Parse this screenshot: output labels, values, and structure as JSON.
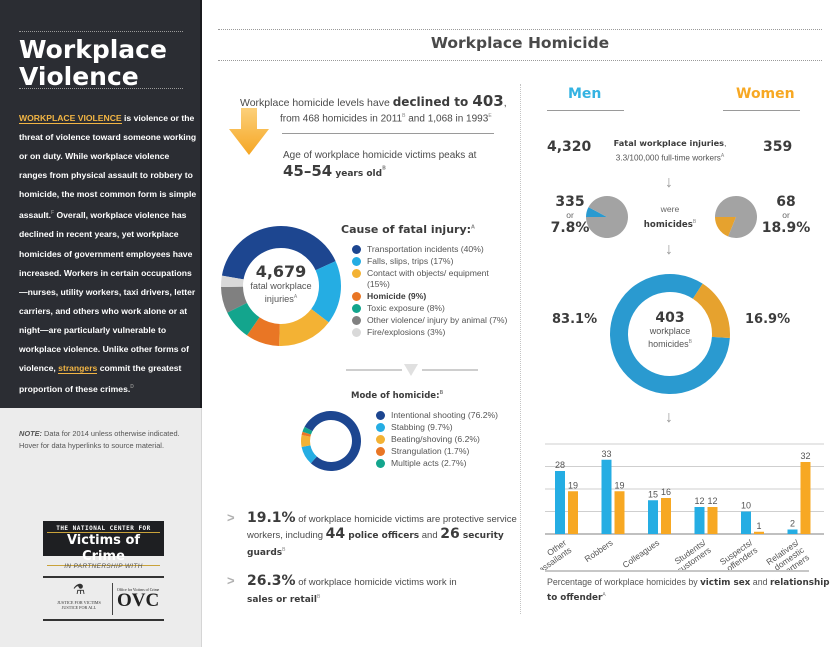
{
  "sidebar": {
    "title_line1": "Workplace",
    "title_line2": "Violence",
    "intro_highlight": "WORKPLACE VIOLENCE",
    "intro_text_1": " is violence or the threat of violence toward someone working or on duty.  While workplace violence ranges from physical assault to robbery to homicide, the most common form is simple assault.",
    "intro_sup_1": "F",
    "intro_text_2": " Overall, workplace violence has declined in recent years, yet workplace homicides of government employees have increased. Workers in certain occupations—nurses, utility workers, taxi drivers, letter carriers, and others who work alone or at night—are particularly vulnerable to workplace violence. Unlike other forms of violence, ",
    "intro_link": "strangers",
    "intro_text_3": " commit the greatest proportion of these crimes.",
    "intro_sup_2": "D",
    "note_label": "NOTE:",
    "note_text": " Data for 2014 unless otherwise indicated. Hover for data hyperlinks to source material.",
    "logo_ncvc_line1": "THE NATIONAL CENTER FOR",
    "logo_ncvc_line2": "Victims of Crime",
    "partnership": "IN PARTNERSHIP WITH",
    "logo_doj_line1": "JUSTICE FOR VICTIMS",
    "logo_doj_line2": "JUSTICE FOR ALL",
    "logo_ovc_small": "Office for Victims of Crime",
    "logo_ovc": "OVC"
  },
  "main": {
    "title": "Workplace Homicide",
    "decline": {
      "text_pre": "Workplace homicide levels have ",
      "bold": "declined to ",
      "bold_num": "403",
      "text_post": ",",
      "line2_a": "from 468 homicides in 2011",
      "line2_sup_a": "B",
      "line2_b": " and 1,068 in 1993",
      "line2_sup_b": "E"
    },
    "age": {
      "text": "Age of  workplace homicide victims peaks at",
      "range": "45–54",
      "suffix": " years old",
      "sup": "B"
    },
    "cause": {
      "title": "Cause of fatal injury:",
      "title_sup": "A",
      "center_num": "4,679",
      "center_label_1": "fatal workplace",
      "center_label_2": "injuries",
      "center_sup": "A"
    },
    "mode": {
      "title": "Mode of homicide:",
      "title_sup": "B"
    },
    "stats": [
      {
        "chevron": ">",
        "pct": "19.1%",
        "text_a": " of workplace homicide victims are protective service workers, including ",
        "num_a": "44",
        "bold_a": " police officers",
        "text_b": " and ",
        "num_b": "26",
        "bold_b": " security guards",
        "sup": "B"
      },
      {
        "chevron": ">",
        "pct": "26.3%",
        "text_a": " of workplace homicide victims work in ",
        "bold_a": "sales or retail",
        "sup": "B"
      }
    ]
  },
  "right": {
    "men_label": "Men",
    "women_label": "Women",
    "men_fatal": "4,320",
    "women_fatal": "359",
    "fatal_label_bold": "Fatal workplace injuries",
    "fatal_label_rest": ",",
    "fatal_rate": "3.3/100,000 full-time workers",
    "fatal_rate_sup": "A",
    "arrow": "↓",
    "men_hom_count": "335",
    "men_hom_or": "or",
    "men_hom_pct": "7.8%",
    "women_hom_count": "68",
    "women_hom_or": "or",
    "women_hom_pct": "18.9%",
    "were": "were",
    "homicides": "homicides",
    "homicides_sup": "B",
    "total_homicides": "403",
    "total_label_1": "workplace",
    "total_label_2": "homicides",
    "total_sup": "B",
    "men_share": "83.1%",
    "women_share": "16.9%",
    "bar_caption_a": "Percentage of workplace homicides by ",
    "bar_caption_b": "victim sex",
    "bar_caption_c": " and ",
    "bar_caption_d": "relationship to offender",
    "bar_caption_sup": "A"
  },
  "colors": {
    "dark_panel": "#2b2d33",
    "accent_gold": "#f2b544",
    "men_blue": "#35b3e2",
    "women_orange": "#f7a823",
    "navy": "#1d4690",
    "gray_pie": "#a3a3a3"
  },
  "chart_data": [
    {
      "type": "pie",
      "title": "Cause of fatal injury",
      "center_text": "4,679 fatal workplace injuries",
      "categories": [
        "Transportation incidents",
        "Falls, slips, trips",
        "Contact with objects/ equipment",
        "Homicide",
        "Toxic exposure",
        "Other violence/ injury by animal",
        "Fire/explosions"
      ],
      "values": [
        40,
        17,
        15,
        9,
        8,
        7,
        3
      ],
      "labels": [
        "Transportation incidents (40%)",
        "Falls, slips, trips (17%)",
        "Contact with objects/ equipment (15%)",
        "Homicide (9%)",
        "Toxic exposure (8%)",
        "Other violence/ injury by animal (7%)",
        "Fire/explosions (3%)"
      ],
      "colors": [
        "#1d4690",
        "#25ade3",
        "#f3b234",
        "#e97625",
        "#13a58d",
        "#808080",
        "#d9d9d9"
      ],
      "bold_index": 3
    },
    {
      "type": "pie",
      "title": "Mode of homicide",
      "categories": [
        "Intentional shooting",
        "Stabbing",
        "Beating/shoving",
        "Strangulation",
        "Multiple acts"
      ],
      "values": [
        76.2,
        9.7,
        6.2,
        1.7,
        2.7
      ],
      "labels": [
        "Intentional shooting (76.2%)",
        "Stabbing (9.7%)",
        "Beating/shoving (6.2%)",
        "Strangulation (1.7%)",
        "Multiple acts (2.7%)"
      ],
      "colors": [
        "#1d4690",
        "#25ade3",
        "#f3b234",
        "#e97625",
        "#13a58d"
      ]
    },
    {
      "type": "pie",
      "title": "Men fatal injuries that were homicides",
      "categories": [
        "Homicides",
        "Other"
      ],
      "values": [
        7.8,
        92.2
      ],
      "colors": [
        "#2a9ad0",
        "#a3a3a3"
      ]
    },
    {
      "type": "pie",
      "title": "Women fatal injuries that were homicides",
      "categories": [
        "Homicides",
        "Other"
      ],
      "values": [
        18.9,
        81.1
      ],
      "colors": [
        "#e6a22e",
        "#a3a3a3"
      ]
    },
    {
      "type": "pie",
      "title": "Workplace homicides by sex",
      "center_text": "403 workplace homicides",
      "categories": [
        "Men",
        "Women"
      ],
      "values": [
        83.1,
        16.9
      ],
      "colors": [
        "#2a9ad0",
        "#e6a22e"
      ]
    },
    {
      "type": "bar",
      "title": "Percentage of workplace homicides by victim sex and relationship to offender",
      "categories": [
        "Other assailants",
        "Robbers",
        "Colleagues",
        "Students/ customers",
        "Suspects/ offenders",
        "Relatives/ domestic partners"
      ],
      "series": [
        {
          "name": "Men",
          "values": [
            28,
            33,
            15,
            12,
            10,
            2
          ],
          "color": "#25ade3"
        },
        {
          "name": "Women",
          "values": [
            19,
            19,
            16,
            12,
            1,
            32
          ],
          "color": "#f7a823"
        }
      ],
      "ylim": [
        0,
        40
      ],
      "grid": true,
      "gridlines": [
        0,
        10,
        20,
        30,
        40
      ],
      "xlabel": "",
      "ylabel": ""
    }
  ]
}
